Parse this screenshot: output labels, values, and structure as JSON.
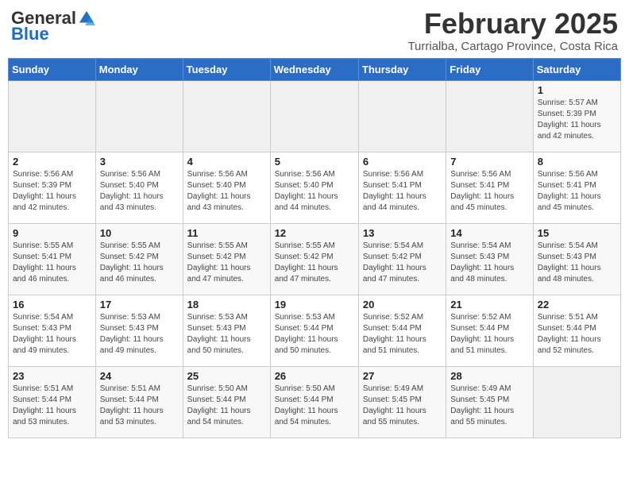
{
  "header": {
    "logo_general": "General",
    "logo_blue": "Blue",
    "month_title": "February 2025",
    "location": "Turrialba, Cartago Province, Costa Rica"
  },
  "days_of_week": [
    "Sunday",
    "Monday",
    "Tuesday",
    "Wednesday",
    "Thursday",
    "Friday",
    "Saturday"
  ],
  "weeks": [
    [
      {
        "day": "",
        "info": ""
      },
      {
        "day": "",
        "info": ""
      },
      {
        "day": "",
        "info": ""
      },
      {
        "day": "",
        "info": ""
      },
      {
        "day": "",
        "info": ""
      },
      {
        "day": "",
        "info": ""
      },
      {
        "day": "1",
        "info": "Sunrise: 5:57 AM\nSunset: 5:39 PM\nDaylight: 11 hours\nand 42 minutes."
      }
    ],
    [
      {
        "day": "2",
        "info": "Sunrise: 5:56 AM\nSunset: 5:39 PM\nDaylight: 11 hours\nand 42 minutes."
      },
      {
        "day": "3",
        "info": "Sunrise: 5:56 AM\nSunset: 5:40 PM\nDaylight: 11 hours\nand 43 minutes."
      },
      {
        "day": "4",
        "info": "Sunrise: 5:56 AM\nSunset: 5:40 PM\nDaylight: 11 hours\nand 43 minutes."
      },
      {
        "day": "5",
        "info": "Sunrise: 5:56 AM\nSunset: 5:40 PM\nDaylight: 11 hours\nand 44 minutes."
      },
      {
        "day": "6",
        "info": "Sunrise: 5:56 AM\nSunset: 5:41 PM\nDaylight: 11 hours\nand 44 minutes."
      },
      {
        "day": "7",
        "info": "Sunrise: 5:56 AM\nSunset: 5:41 PM\nDaylight: 11 hours\nand 45 minutes."
      },
      {
        "day": "8",
        "info": "Sunrise: 5:56 AM\nSunset: 5:41 PM\nDaylight: 11 hours\nand 45 minutes."
      }
    ],
    [
      {
        "day": "9",
        "info": "Sunrise: 5:55 AM\nSunset: 5:41 PM\nDaylight: 11 hours\nand 46 minutes."
      },
      {
        "day": "10",
        "info": "Sunrise: 5:55 AM\nSunset: 5:42 PM\nDaylight: 11 hours\nand 46 minutes."
      },
      {
        "day": "11",
        "info": "Sunrise: 5:55 AM\nSunset: 5:42 PM\nDaylight: 11 hours\nand 47 minutes."
      },
      {
        "day": "12",
        "info": "Sunrise: 5:55 AM\nSunset: 5:42 PM\nDaylight: 11 hours\nand 47 minutes."
      },
      {
        "day": "13",
        "info": "Sunrise: 5:54 AM\nSunset: 5:42 PM\nDaylight: 11 hours\nand 47 minutes."
      },
      {
        "day": "14",
        "info": "Sunrise: 5:54 AM\nSunset: 5:43 PM\nDaylight: 11 hours\nand 48 minutes."
      },
      {
        "day": "15",
        "info": "Sunrise: 5:54 AM\nSunset: 5:43 PM\nDaylight: 11 hours\nand 48 minutes."
      }
    ],
    [
      {
        "day": "16",
        "info": "Sunrise: 5:54 AM\nSunset: 5:43 PM\nDaylight: 11 hours\nand 49 minutes."
      },
      {
        "day": "17",
        "info": "Sunrise: 5:53 AM\nSunset: 5:43 PM\nDaylight: 11 hours\nand 49 minutes."
      },
      {
        "day": "18",
        "info": "Sunrise: 5:53 AM\nSunset: 5:43 PM\nDaylight: 11 hours\nand 50 minutes."
      },
      {
        "day": "19",
        "info": "Sunrise: 5:53 AM\nSunset: 5:44 PM\nDaylight: 11 hours\nand 50 minutes."
      },
      {
        "day": "20",
        "info": "Sunrise: 5:52 AM\nSunset: 5:44 PM\nDaylight: 11 hours\nand 51 minutes."
      },
      {
        "day": "21",
        "info": "Sunrise: 5:52 AM\nSunset: 5:44 PM\nDaylight: 11 hours\nand 51 minutes."
      },
      {
        "day": "22",
        "info": "Sunrise: 5:51 AM\nSunset: 5:44 PM\nDaylight: 11 hours\nand 52 minutes."
      }
    ],
    [
      {
        "day": "23",
        "info": "Sunrise: 5:51 AM\nSunset: 5:44 PM\nDaylight: 11 hours\nand 53 minutes."
      },
      {
        "day": "24",
        "info": "Sunrise: 5:51 AM\nSunset: 5:44 PM\nDaylight: 11 hours\nand 53 minutes."
      },
      {
        "day": "25",
        "info": "Sunrise: 5:50 AM\nSunset: 5:44 PM\nDaylight: 11 hours\nand 54 minutes."
      },
      {
        "day": "26",
        "info": "Sunrise: 5:50 AM\nSunset: 5:44 PM\nDaylight: 11 hours\nand 54 minutes."
      },
      {
        "day": "27",
        "info": "Sunrise: 5:49 AM\nSunset: 5:45 PM\nDaylight: 11 hours\nand 55 minutes."
      },
      {
        "day": "28",
        "info": "Sunrise: 5:49 AM\nSunset: 5:45 PM\nDaylight: 11 hours\nand 55 minutes."
      },
      {
        "day": "",
        "info": ""
      }
    ]
  ]
}
